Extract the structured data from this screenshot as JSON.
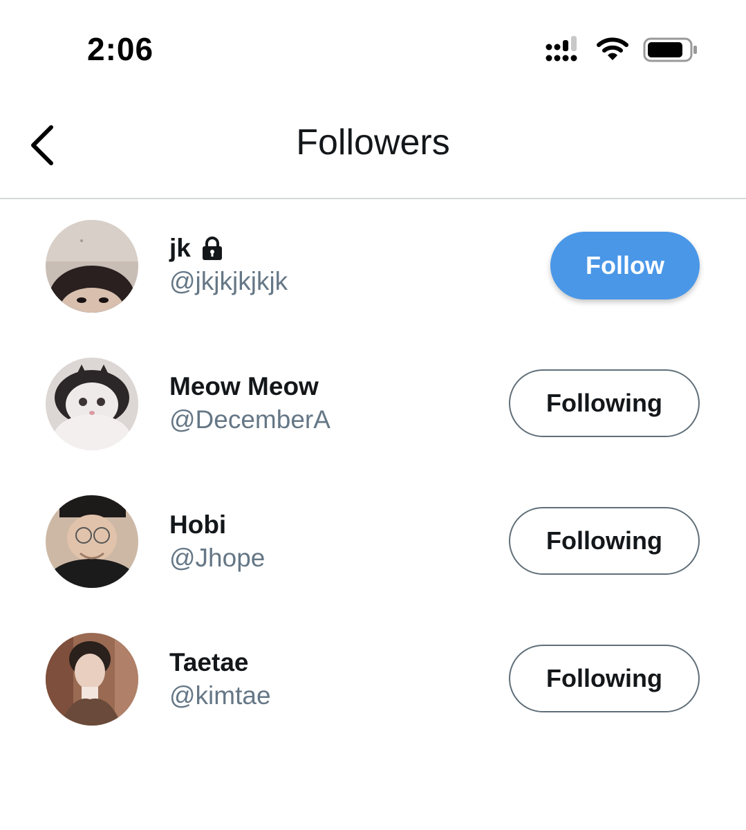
{
  "status_bar": {
    "time": "2:06",
    "icons": [
      "cellular-signal-icon",
      "wifi-icon",
      "battery-icon"
    ]
  },
  "header": {
    "title": "Followers",
    "back_icon": "chevron-left-icon"
  },
  "colors": {
    "accent": "#4a97e8",
    "handle_text": "#657786",
    "button_border": "#5f6e78",
    "divider": "#d4d8db"
  },
  "followers": [
    {
      "name": "jk",
      "handle": "@jkjkjkjkjk",
      "locked": true,
      "button_label": "Follow",
      "button_style": "primary"
    },
    {
      "name": "Meow Meow",
      "handle": "@DecemberA",
      "locked": false,
      "button_label": "Following",
      "button_style": "outline"
    },
    {
      "name": "Hobi",
      "handle": "@Jhope",
      "locked": false,
      "button_label": "Following",
      "button_style": "outline"
    },
    {
      "name": "Taetae",
      "handle": "@kimtae",
      "locked": false,
      "button_label": "Following",
      "button_style": "outline"
    }
  ]
}
